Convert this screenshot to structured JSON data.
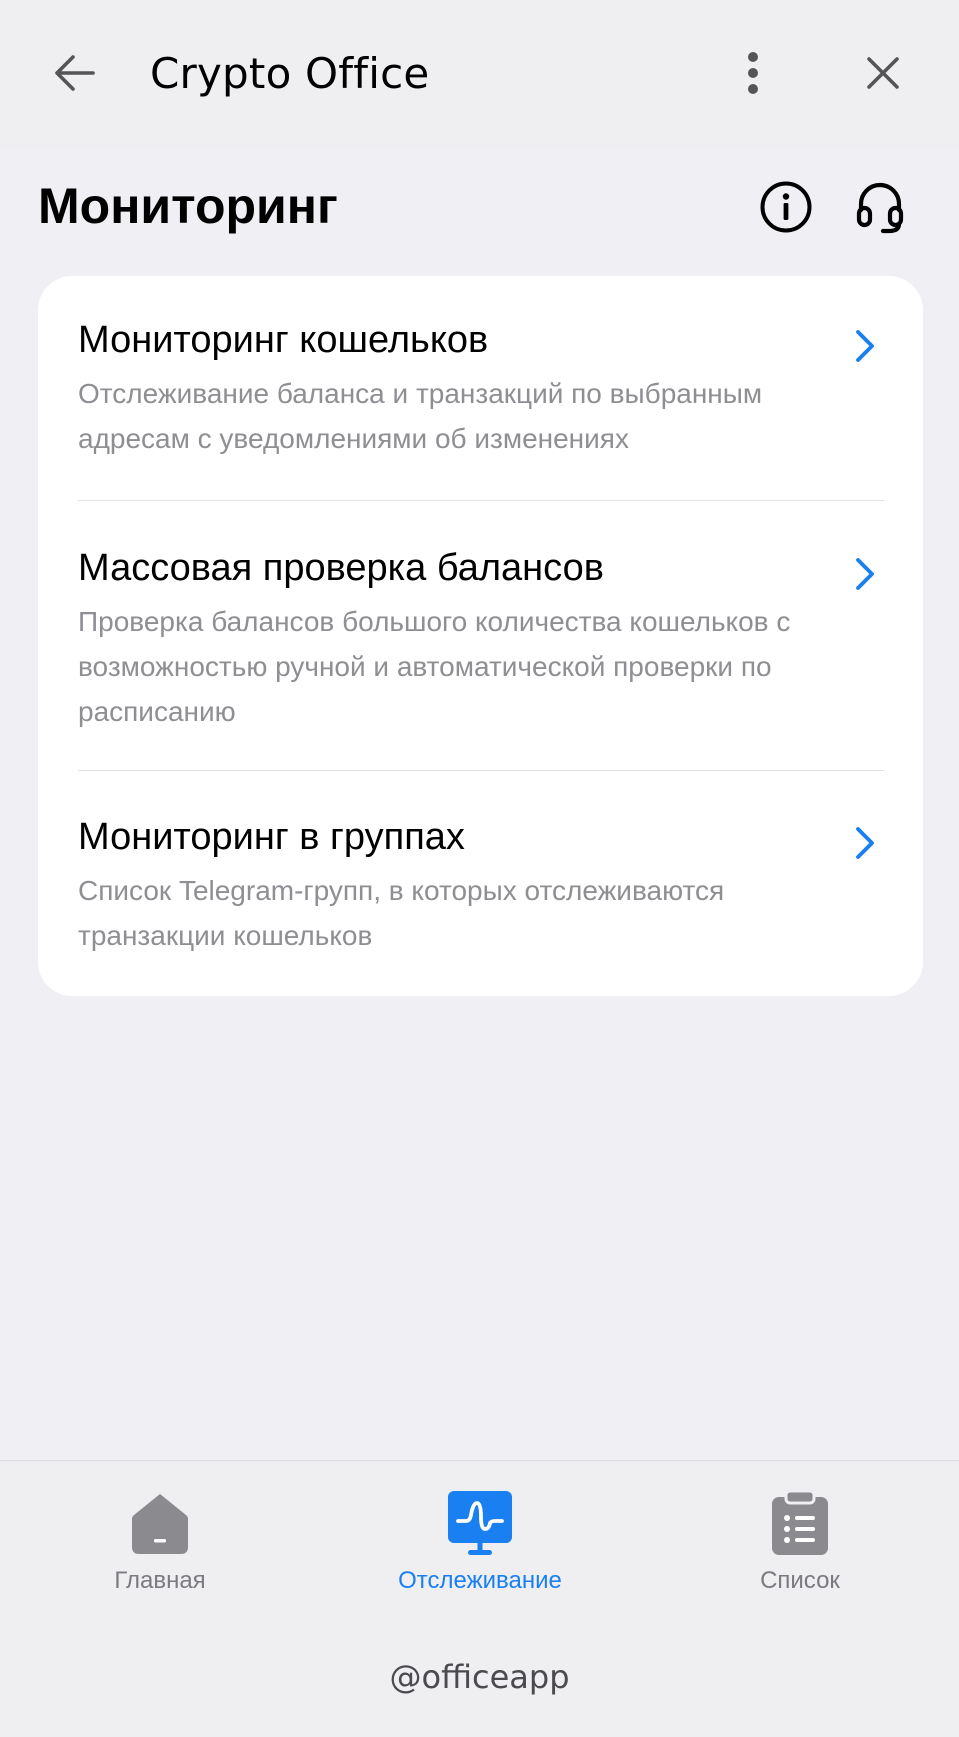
{
  "header": {
    "app_title": "Crypto Office",
    "back_icon": "arrow-left-icon",
    "more_icon": "vertical-dots-icon",
    "close_icon": "close-icon"
  },
  "page": {
    "title": "Мониторинг",
    "info_icon": "info-icon",
    "support_icon": "headset-icon"
  },
  "menu": {
    "items": [
      {
        "title": "Мониторинг кошельков",
        "description": "Отслеживание баланса и транзакций по выбранным адресам с уведомлениями об изменениях",
        "icon": "chevron-right-icon"
      },
      {
        "title": "Массовая проверка балансов",
        "description": "Проверка балансов большого количества кошельков с возможностью ручной и автоматической проверки по расписанию",
        "icon": "chevron-right-icon"
      },
      {
        "title": "Мониторинг в группах",
        "description": "Список Telegram-групп, в которых отслеживаются транзакции кошельков",
        "icon": "chevron-right-icon"
      }
    ]
  },
  "bottom_nav": {
    "tabs": [
      {
        "label": "Главная",
        "icon": "home-icon",
        "active": false
      },
      {
        "label": "Отслеживание",
        "icon": "monitor-icon",
        "active": true
      },
      {
        "label": "Список",
        "icon": "clipboard-list-icon",
        "active": false
      }
    ],
    "handle": "@officeapp"
  },
  "colors": {
    "accent": "#1a7ff0",
    "background": "#efeff4",
    "card": "#ffffff",
    "secondary_text": "#8e8e93",
    "inactive_icon": "#8a8a8f"
  }
}
